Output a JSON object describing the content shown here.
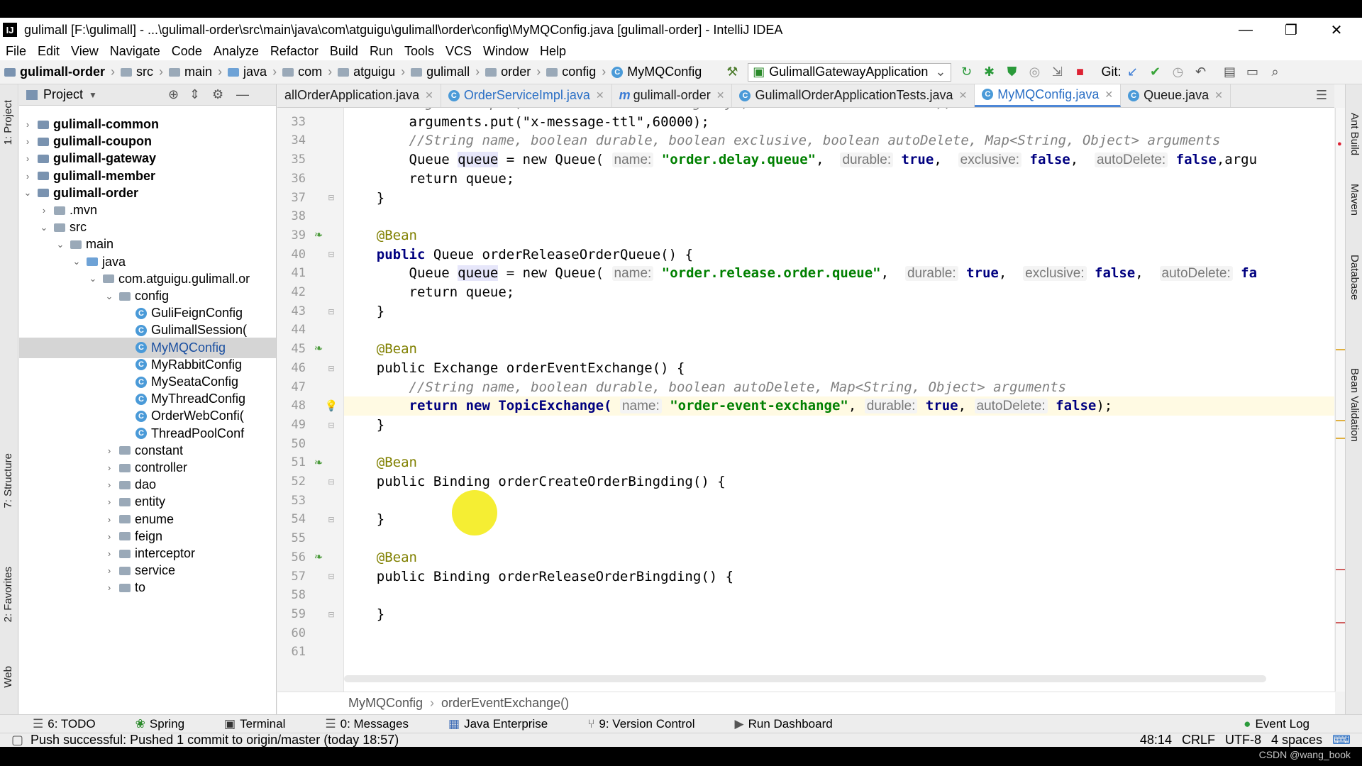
{
  "window": {
    "title": "gulimall [F:\\gulimall] - ...\\gulimall-order\\src\\main\\java\\com\\atguigu\\gulimall\\order\\config\\MyMQConfig.java [gulimall-order] - IntelliJ IDEA",
    "app_icon": "IJ"
  },
  "menu": [
    "File",
    "Edit",
    "View",
    "Navigate",
    "Code",
    "Analyze",
    "Refactor",
    "Build",
    "Run",
    "Tools",
    "VCS",
    "Window",
    "Help"
  ],
  "nav_breadcrumb": [
    "gulimall-order",
    "src",
    "main",
    "java",
    "com",
    "atguigu",
    "gulimall",
    "order",
    "config",
    "MyMQConfig"
  ],
  "run_config": "GulimallGatewayApplication",
  "git_label": "Git:",
  "project_panel": {
    "title": "Project",
    "tree": [
      {
        "label": "gulimall-common",
        "bold": true
      },
      {
        "label": "gulimall-coupon",
        "bold": true
      },
      {
        "label": "gulimall-gateway",
        "bold": true
      },
      {
        "label": "gulimall-member",
        "bold": true
      },
      {
        "label": "gulimall-order",
        "bold": true
      },
      {
        "label": ".mvn"
      },
      {
        "label": "src"
      },
      {
        "label": "main"
      },
      {
        "label": "java"
      },
      {
        "label": "com.atguigu.gulimall.or"
      },
      {
        "label": "config"
      },
      {
        "label": "GuliFeignConfig"
      },
      {
        "label": "GulimallSession("
      },
      {
        "label": "MyMQConfig",
        "selected": true
      },
      {
        "label": "MyRabbitConfig"
      },
      {
        "label": "MySeataConfig"
      },
      {
        "label": "MyThreadConfig"
      },
      {
        "label": "OrderWebConfi("
      },
      {
        "label": "ThreadPoolConf"
      },
      {
        "label": "constant"
      },
      {
        "label": "controller"
      },
      {
        "label": "dao"
      },
      {
        "label": "entity"
      },
      {
        "label": "enume"
      },
      {
        "label": "feign"
      },
      {
        "label": "interceptor"
      },
      {
        "label": "service"
      },
      {
        "label": "to"
      }
    ]
  },
  "left_stripe": {
    "project": "1: Project",
    "structure": "7: Structure",
    "favorites": "2: Favorites",
    "web": "Web"
  },
  "right_stripe": {
    "ant": "Ant Build",
    "maven": "Maven",
    "database": "Database",
    "bean": "Bean Validation"
  },
  "editor_tabs": [
    {
      "label": "allOrderApplication.java"
    },
    {
      "label": "OrderServiceImpl.java"
    },
    {
      "label": "gulimall-order"
    },
    {
      "label": "GulimallOrderApplicationTests.java"
    },
    {
      "label": "MyMQConfig.java",
      "active": true
    },
    {
      "label": "Queue.java"
    }
  ],
  "line_numbers": [
    "33",
    "34",
    "35",
    "36",
    "37",
    "38",
    "39",
    "40",
    "41",
    "42",
    "43",
    "44",
    "45",
    "46",
    "47",
    "48",
    "49",
    "50",
    "51",
    "52",
    "53",
    "54",
    "55",
    "56",
    "57",
    "58",
    "59",
    "60",
    "61"
  ],
  "code": {
    "l33": "        arguments.put(\"x-message-ttl\",60000);",
    "l34": "        //String name, boolean durable, boolean exclusive, boolean autoDelete, Map<String, Object> arguments",
    "l35a": "        Queue ",
    "l35b": "queue",
    "l35c": " = new Queue( ",
    "l35h1": "name:",
    "l35s": " \"order.delay.queue\"",
    "l35d": ",  ",
    "l35h2": "durable:",
    "l35t": " true",
    "l35e": ",  ",
    "l35h3": "exclusive:",
    "l35f": " false",
    "l35g": ",  ",
    "l35h4": "autoDelete:",
    "l35k": " false",
    "l35m": ",argu",
    "l36": "        return queue;",
    "l37": "    }",
    "l39": "    @Bean",
    "l40a": "    public ",
    "l40b": "Queue orderReleaseOrderQueue() {",
    "l41a": "        Queue ",
    "l41b": "queue",
    "l41c": " = new Queue( ",
    "l41h1": "name:",
    "l41s": " \"order.release.order.queue\"",
    "l41d": ",  ",
    "l41h2": "durable:",
    "l41t": " true",
    "l41e": ",  ",
    "l41h3": "exclusive:",
    "l41f": " false",
    "l41g": ",  ",
    "l41h4": "autoDelete:",
    "l41k": " fa",
    "l42": "        return queue;",
    "l43": "    }",
    "l45": "    @Bean",
    "l46": "    public Exchange orderEventExchange() {",
    "l47": "        //String name, boolean durable, boolean autoDelete, Map<String, Object> arguments",
    "l48a": "        return new TopicExchange( ",
    "l48h1": "name:",
    "l48s": " \"order-event-exchange\"",
    "l48d": ", ",
    "l48h2": "durable:",
    "l48t": " true",
    "l48e": ", ",
    "l48h3": "autoDelete:",
    "l48f": " false",
    "l48g": ");",
    "l49": "    }",
    "l51": "    @Bean",
    "l52": "    public Binding orderCreateOrderBingding() {",
    "l54": "    }",
    "l56": "    @Bean",
    "l57": "    public Binding orderReleaseOrderBingding() {",
    "l59": "    }"
  },
  "editor_breadcrumb": [
    "MyMQConfig",
    "orderEventExchange()"
  ],
  "bottom_tools": [
    "6: TODO",
    "Spring",
    "Terminal",
    "0: Messages",
    "Java Enterprise",
    "9: Version Control",
    "Run Dashboard"
  ],
  "event_log": "Event Log",
  "status": {
    "message": "Push successful: Pushed 1 commit to origin/master (today 18:57)",
    "position": "48:14",
    "line_sep": "CRLF",
    "encoding": "UTF-8",
    "indent": "4 spaces"
  },
  "watermark": "CSDN @wang_book"
}
